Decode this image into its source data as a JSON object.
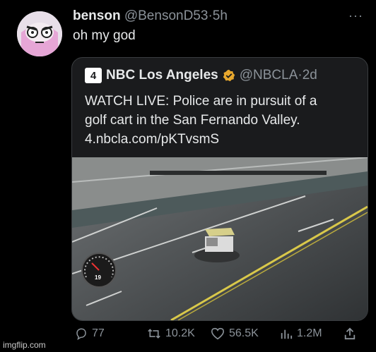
{
  "post": {
    "display_name": "benson",
    "handle": "@BensonD53",
    "separator": "·",
    "time": "5h",
    "text": "oh my god",
    "more": "···"
  },
  "quoted": {
    "logo_text": "4",
    "display_name": "NBC Los Angeles",
    "handle": "@NBCLA",
    "separator": "·",
    "time": "2d",
    "text_lines": [
      "WATCH LIVE: Police are in pursuit of a",
      "golf cart in the San Fernando Valley.",
      "4.nbcla.com/pKTvsmS"
    ],
    "video": {
      "speed": "19"
    }
  },
  "actions": {
    "replies": "77",
    "retweets": "10.2K",
    "likes": "56.5K",
    "views": "1.2M"
  },
  "watermark": "imgflip.com",
  "colors": {
    "background": "#000000",
    "text": "#e7e9ea",
    "muted": "#8b9299",
    "verified": "#e8a82e",
    "road_line": "#d9c84a"
  }
}
